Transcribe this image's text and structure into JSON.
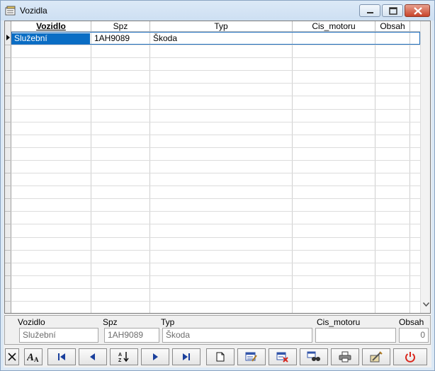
{
  "window": {
    "title": "Vozidla"
  },
  "grid": {
    "columns": [
      "Vozidlo",
      "Spz",
      "Typ",
      "Cis_motoru",
      "Obsah"
    ],
    "rows": [
      {
        "vozidlo": "Služební",
        "spz": "1AH9089",
        "typ": "Škoda",
        "cis_motoru": "",
        "obsah": ""
      }
    ]
  },
  "detail": {
    "labels": {
      "vozidlo": "Vozidlo",
      "spz": "Spz",
      "typ": "Typ",
      "cis_motoru": "Cis_motoru",
      "obsah": "Obsah"
    },
    "values": {
      "vozidlo": "Služební",
      "spz": "1AH9089",
      "typ": "Škoda",
      "cis_motoru": "",
      "obsah": "0"
    }
  },
  "toolbar": {
    "buttons": [
      "close-form",
      "font",
      "first-record",
      "previous-record",
      "sort",
      "next-record",
      "last-record",
      "new-record",
      "edit-record",
      "delete-record",
      "find",
      "print",
      "tools",
      "exit"
    ]
  },
  "colors": {
    "selection": "#0a6dc4",
    "nav_arrow": "#1a3f9c",
    "exit_red": "#d9261c"
  }
}
